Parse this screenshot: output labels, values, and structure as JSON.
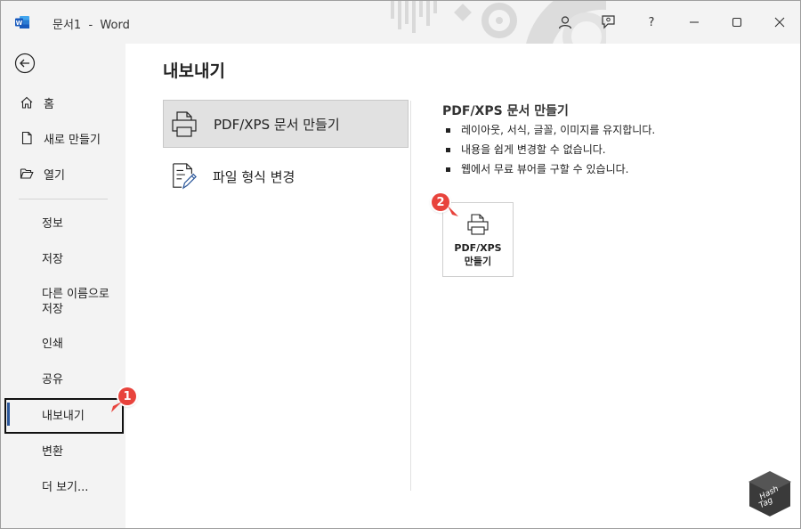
{
  "titlebar": {
    "app_icon": "word-logo",
    "title": "문서1  -  Word",
    "buttons": [
      "account-icon",
      "coauthoring-icon",
      "help-icon",
      "minimize-icon",
      "maximize-icon",
      "close-icon"
    ],
    "help_glyph": "?",
    "minimize_glyph": "—",
    "close_glyph": "✕"
  },
  "nav": {
    "back_icon": "back-arrow-icon",
    "top_items": [
      {
        "label": "홈",
        "icon": "home-icon"
      },
      {
        "label": "새로 만들기",
        "icon": "new-document-icon"
      },
      {
        "label": "열기",
        "icon": "open-folder-icon"
      }
    ],
    "items": [
      {
        "label": "정보"
      },
      {
        "label": "저장"
      },
      {
        "label": "다른 이름으로 저장"
      },
      {
        "label": "인쇄"
      },
      {
        "label": "공유"
      },
      {
        "label": "내보내기",
        "selected": true
      },
      {
        "label": "변환"
      },
      {
        "label": "더 보기..."
      }
    ]
  },
  "main": {
    "title": "내보내기",
    "options": [
      {
        "label": "PDF/XPS 문서 만들기",
        "icon": "pdf-printer-icon",
        "active": true
      },
      {
        "label": "파일 형식 변경",
        "icon": "change-file-type-icon",
        "active": false
      }
    ],
    "detail": {
      "title": "PDF/XPS 문서 만들기",
      "bullets": [
        "레이아웃, 서식, 글꼴, 이미지를 유지합니다.",
        "내용을 쉽게 변경할 수 없습니다.",
        "웹에서 무료 뷰어를 구할 수 있습니다."
      ],
      "button_line1": "PDF/XPS",
      "button_line2": "만들기"
    }
  },
  "annotations": {
    "badge1": "1",
    "badge2": "2",
    "badge_color": "#e8433c"
  },
  "watermark": {
    "line1": "Hash",
    "line2": "Tag"
  },
  "colors": {
    "chrome": "#f3f3f3",
    "accent": "#2b579a",
    "active_option": "#e1e1e1"
  }
}
